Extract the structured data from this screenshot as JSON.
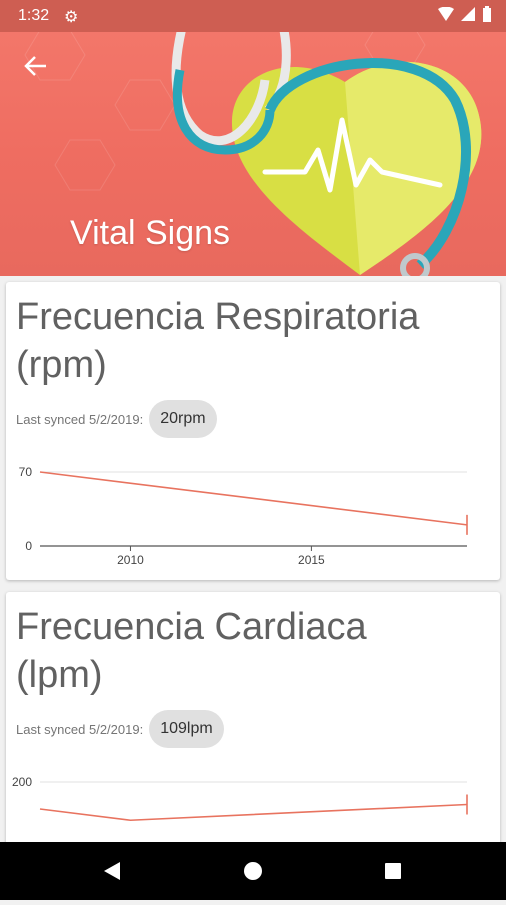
{
  "status": {
    "time": "1:32"
  },
  "header": {
    "title": "Vital Signs"
  },
  "cards": [
    {
      "title_line1": "Frecuencia Respiratoria",
      "title_line2": "(rpm)",
      "sync_label": "Last synced 5/2/2019:",
      "chip": "20rpm"
    },
    {
      "title_line1": "Frecuencia Cardiaca",
      "title_line2": "(lpm)",
      "sync_label": "Last synced 5/2/2019:",
      "chip": "109lpm"
    }
  ],
  "chart_data": [
    {
      "type": "line",
      "y_ticks": [
        "70",
        "0"
      ],
      "x_ticks": [
        "2010",
        "2015"
      ],
      "xlim": [
        2007.5,
        2019.3
      ],
      "ylim": [
        0,
        70
      ],
      "series": [
        {
          "x": [
            2007.5,
            2019.3
          ],
          "values": [
            70,
            20
          ]
        }
      ],
      "color": "#e8735f"
    },
    {
      "type": "line",
      "y_ticks": [
        "200"
      ],
      "xlim": [
        2007.5,
        2019.3
      ],
      "ylim": [
        0,
        200
      ],
      "series": [
        {
          "x": [
            2007.5,
            2010,
            2019.3
          ],
          "values": [
            140,
            115,
            150
          ]
        }
      ],
      "color": "#e8735f"
    }
  ]
}
